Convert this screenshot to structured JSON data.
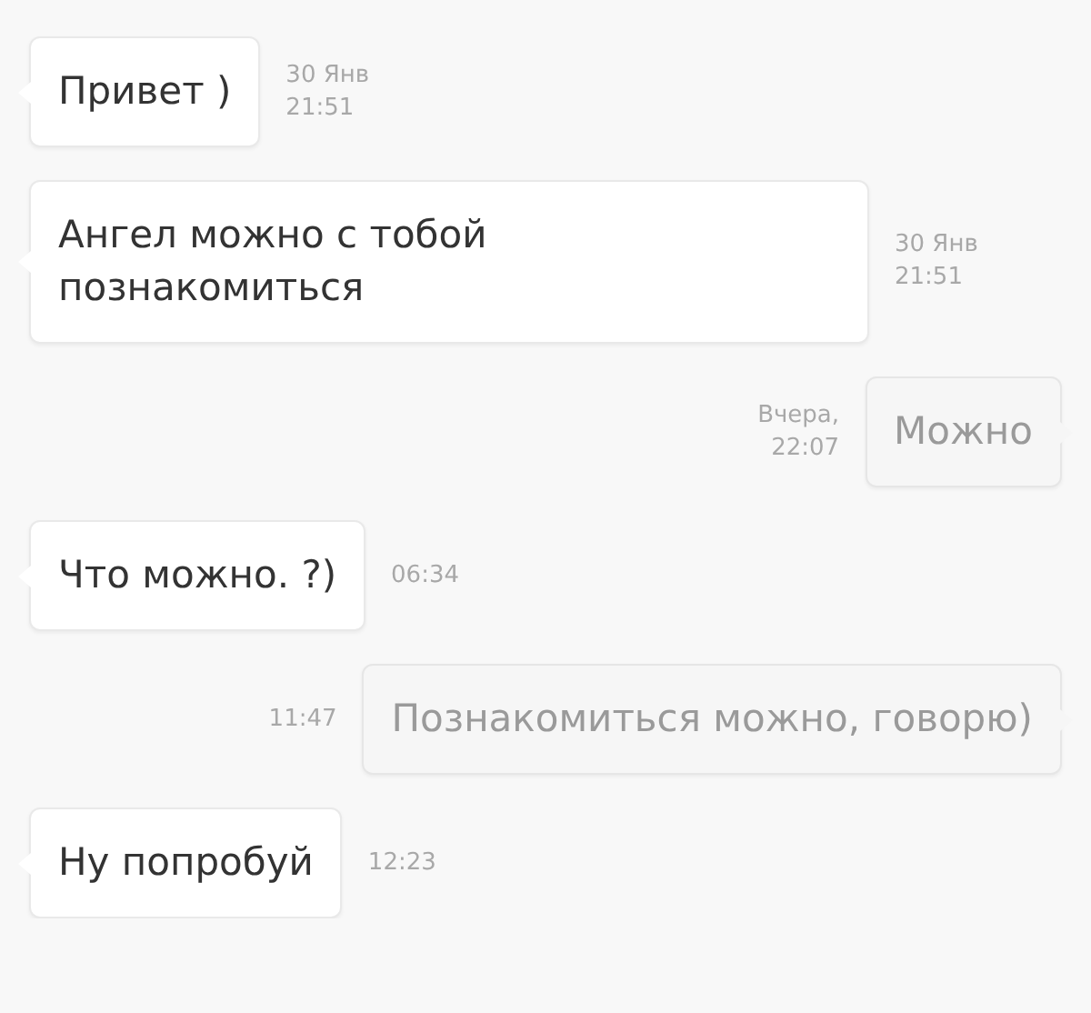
{
  "messages": [
    {
      "kind": "incoming",
      "text": "Привет )",
      "time": "30 Янв 21:51"
    },
    {
      "kind": "incoming",
      "text": "Ангел можно с тобой познакомиться",
      "time": "30 Янв 21:51"
    },
    {
      "kind": "outgoing",
      "text": "Можно",
      "time": "Вчера, 22:07"
    },
    {
      "kind": "incoming",
      "text": "Что можно. ?)",
      "time": "06:34"
    },
    {
      "kind": "outgoing",
      "text": "Познакомиться можно, говорю)",
      "time": "11:47"
    },
    {
      "kind": "incoming",
      "text": "Ну попробуй",
      "time": "12:23"
    }
  ]
}
